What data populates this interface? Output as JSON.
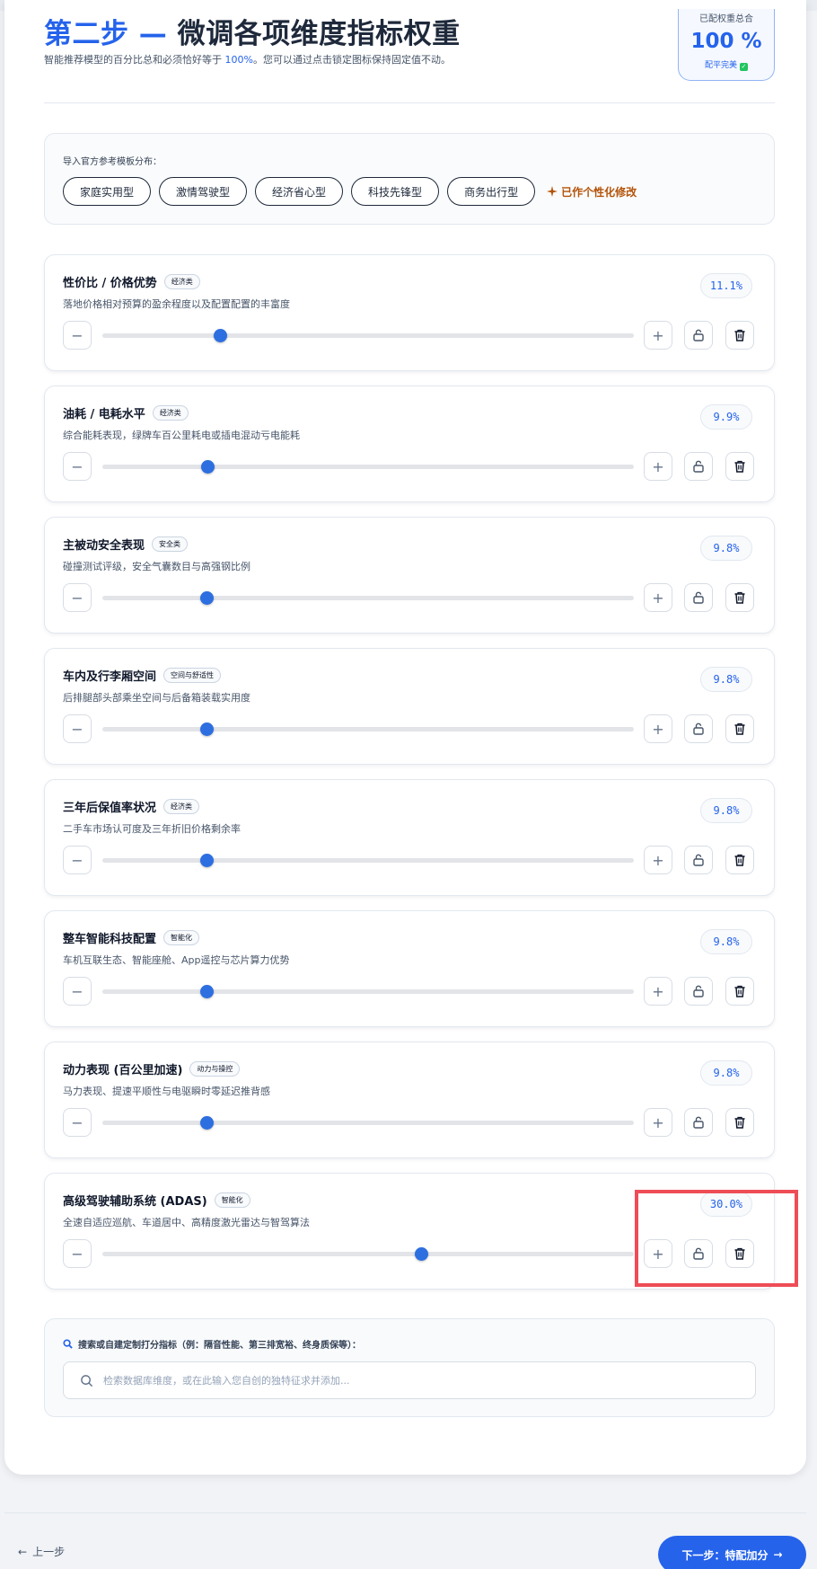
{
  "header": {
    "title_accent": "第二步 —",
    "title_main": "微调各项维度指标权重",
    "subtitle_prefix": "智能推荐模型的百分比总和必须恰好等于",
    "subtitle_pct": "100%",
    "subtitle_suffix": "。您可以通过点击锁定图标保持固定值不动。",
    "total_label": "已配权重总合",
    "total_value": "100 %",
    "total_status": "配平完美",
    "total_status_icon": "check-square-icon"
  },
  "templates": {
    "title": "导入官方参考模板分布：",
    "chips": [
      "家庭实用型",
      "激情驾驶型",
      "经济省心型",
      "科技先锋型",
      "商务出行型"
    ],
    "modified_label": "已作个性化修改",
    "modified_icon": "sparkle-icon"
  },
  "accent_color": "#2563eb",
  "metrics": [
    {
      "name": "性价比 / 价格优势",
      "tag": "经济类",
      "desc": "落地价格相对预算的盈余程度以及配置配置的丰富度",
      "value": "11.1%",
      "weight": 11.1
    },
    {
      "name": "油耗 / 电耗水平",
      "tag": "经济类",
      "desc": "综合能耗表现，绿牌车百公里耗电或插电混动亏电能耗",
      "value": "9.9%",
      "weight": 9.9
    },
    {
      "name": "主被动安全表现",
      "tag": "安全类",
      "desc": "碰撞测试评级，安全气囊数目与高强钢比例",
      "value": "9.8%",
      "weight": 9.8
    },
    {
      "name": "车内及行李厢空间",
      "tag": "空间与舒适性",
      "desc": "后排腿部头部乘坐空间与后备箱装载实用度",
      "value": "9.8%",
      "weight": 9.8
    },
    {
      "name": "三年后保值率状况",
      "tag": "经济类",
      "desc": "二手车市场认可度及三年折旧价格剩余率",
      "value": "9.8%",
      "weight": 9.8
    },
    {
      "name": "整车智能科技配置",
      "tag": "智能化",
      "desc": "车机互联生态、智能座舱、App遥控与芯片算力优势",
      "value": "9.8%",
      "weight": 9.8
    },
    {
      "name": "动力表现 (百公里加速)",
      "tag": "动力与操控",
      "desc": "马力表现、提速平顺性与电驱瞬时零延迟推背感",
      "value": "9.8%",
      "weight": 9.8
    },
    {
      "name": "高级驾驶辅助系统 (ADAS)",
      "tag": "智能化",
      "desc": "全速自适应巡航、车道居中、高精度激光雷达与智驾算法",
      "value": "30.0%",
      "weight": 30.0
    }
  ],
  "search": {
    "title": "搜索或自建定制打分指标（例：隔音性能、第三排宽裕、终身质保等）：",
    "title_icon": "magnifier-icon",
    "placeholder": "检索数据库维度，或在此输入您自创的独特征求并添加...",
    "value": ""
  },
  "footer": {
    "back_label": "上一步",
    "next_label": "下一步：特配加分"
  }
}
